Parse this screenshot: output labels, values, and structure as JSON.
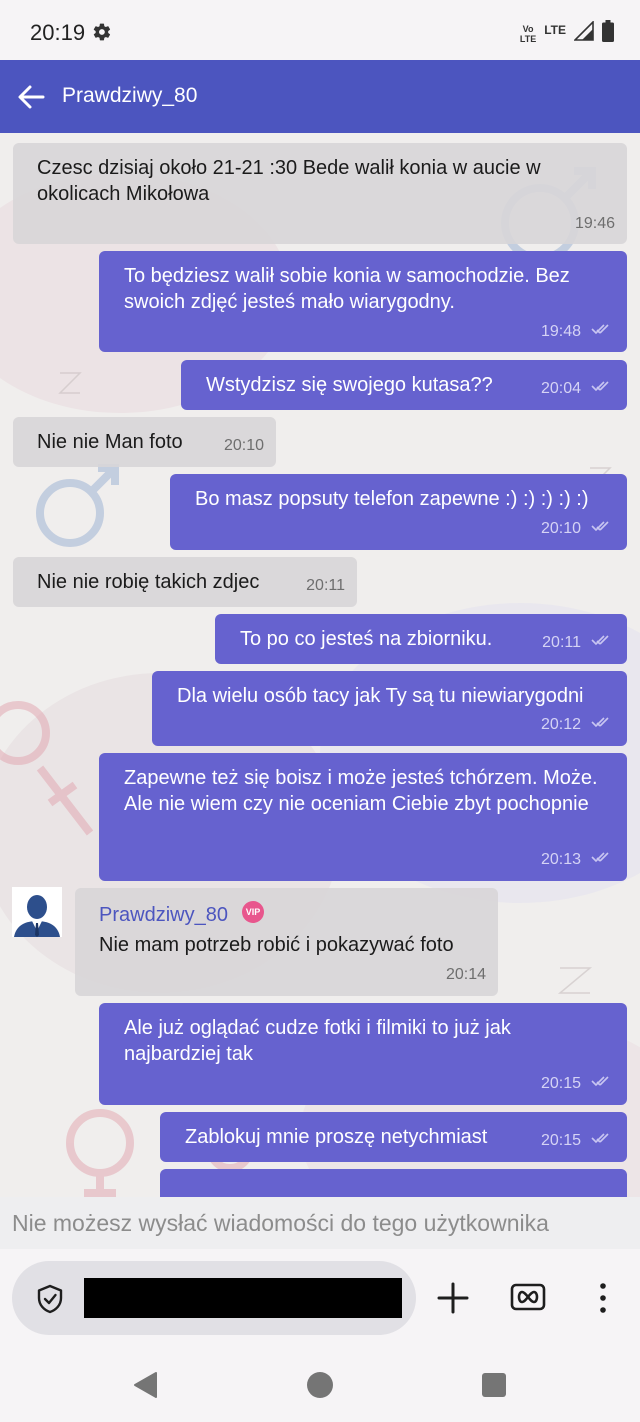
{
  "status_bar": {
    "time": "20:19",
    "volte_top": "Vo",
    "volte_bottom": "LTE",
    "network": "LTE"
  },
  "header": {
    "title": "Prawdziwy_80"
  },
  "messages": [
    {
      "dir": "in",
      "text": "Czesc dzisiaj około 21-21 :30 Bede walił konia w aucie w okolicach Mikołowa",
      "time": "19:46"
    },
    {
      "dir": "out",
      "text": "To będziesz walił sobie konia w samochodzie. Bez swoich zdjęć jesteś mało wiarygodny.",
      "time": "19:48"
    },
    {
      "dir": "out",
      "text": "Wstydzisz się swojego kutasa??",
      "time": "20:04"
    },
    {
      "dir": "in",
      "text": "Nie nie Man foto",
      "time": "20:10"
    },
    {
      "dir": "out",
      "text": "Bo masz popsuty telefon zapewne :) :) :) :) :)",
      "time": "20:10"
    },
    {
      "dir": "in",
      "text": "Nie nie robię takich zdjec",
      "time": "20:11"
    },
    {
      "dir": "out",
      "text": "To po co jesteś na zbiorniku.",
      "time": "20:11"
    },
    {
      "dir": "out",
      "text": "Dla wielu osób tacy jak Ty są tu niewiarygodni",
      "time": "20:12"
    },
    {
      "dir": "out",
      "text": "Zapewne też się boisz i może jesteś tchórzem. Może. Ale nie wiem czy nie oceniam Ciebie zbyt pochopnie",
      "time": "20:13"
    },
    {
      "dir": "in",
      "sender": "Prawdziwy_80",
      "badge": "VIP",
      "text": "Nie mam potrzeb robić i pokazywać foto",
      "time": "20:14"
    },
    {
      "dir": "out",
      "text": "Ale już oglądać cudze fotki i filmiki to już jak najbardziej tak",
      "time": "20:15"
    },
    {
      "dir": "out",
      "text": "Zablokuj mnie proszę netychmiast",
      "time": "20:15"
    }
  ],
  "blocked_notice": "Nie możesz wysłać wiadomości do tego użytkownika",
  "icons": {
    "status": [
      "gear-icon",
      "signal-icon",
      "battery-icon"
    ],
    "input_bar": [
      "shield-check-icon",
      "plus-icon",
      "infinity-icon",
      "more-vertical-icon"
    ],
    "nav": [
      "nav-back-icon",
      "nav-home-icon",
      "nav-recents-icon"
    ]
  },
  "colors": {
    "app_bar": "#4c55bf",
    "outgoing_bubble": "#6662cf",
    "incoming_bubble": "#d8d6d8",
    "vip_badge": "#e8568d"
  }
}
